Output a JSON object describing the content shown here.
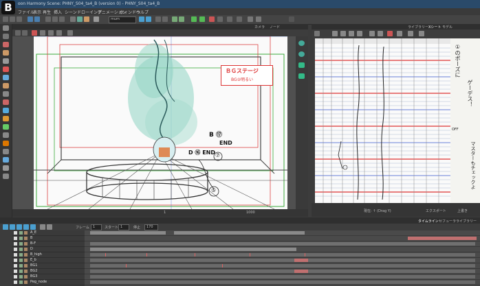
{
  "window": {
    "title": "oon Harmony Scene: PHNY_S04_ta4_B (version 0) - PHNY_S04_ta4_B"
  },
  "menu": [
    "ファイル",
    "表示",
    "再生",
    "挿入",
    "シーン",
    "ドローイング",
    "アニメーション",
    "ウィンドウ",
    "ヘルプ"
  ],
  "toolbar": {
    "zoom_value": "mum"
  },
  "camera": {
    "tabs": [
      "カメラ",
      "ノード"
    ],
    "stage_label": "ＢＧステージ",
    "stage_sublabel": "BG②明るい",
    "note_b": "B ⑰",
    "note_b_end": "END",
    "note_d": "D ⑯ END",
    "circle_num_1": "⑦",
    "circle_num_2": "⑤",
    "status_left": "1",
    "status_mid": "1000"
  },
  "xsheet": {
    "tabs": [
      "ライブラリー",
      "Xシート",
      "モデル"
    ],
    "status_left": "現在: ↑ (Drag Y)",
    "status_right": "エクスポート",
    "status_right2": "上書き",
    "side_text_top": "①のポーズに",
    "side_text_mid": "ゲーデス！",
    "side_text_bottom": "マスターもチェックよ",
    "side_text_off": "OFF"
  },
  "timeline": {
    "tabs": [
      "タイムライン",
      "セフューラライブラリー"
    ],
    "frame_label": "フレーム",
    "frame_value": "1",
    "start_label": "スタート",
    "start_value": "1",
    "stop_label": "停止",
    "stop_value": "170",
    "layers": [
      {
        "name": "A_E"
      },
      {
        "name": "B"
      },
      {
        "name": "B-F"
      },
      {
        "name": "D"
      },
      {
        "name": "B_high"
      },
      {
        "name": "E_b"
      },
      {
        "name": "BG1"
      },
      {
        "name": "BG2"
      },
      {
        "name": "BG3"
      },
      {
        "name": "Peg_node"
      }
    ]
  },
  "icons": {
    "logo": "B"
  }
}
